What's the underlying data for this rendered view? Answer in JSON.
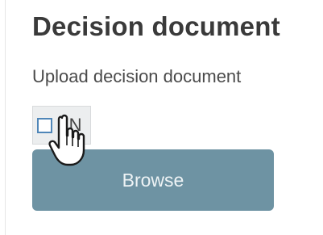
{
  "section": {
    "title": "Decision document",
    "subtitle": "Upload decision document"
  },
  "language_toggle": {
    "label": "EN",
    "checked": false
  },
  "upload": {
    "browse_label": "Browse"
  },
  "colors": {
    "button_bg": "#6e93a3",
    "checkbox_border": "#4f86b8"
  },
  "icons": {
    "cursor": "hand-pointer-icon"
  }
}
